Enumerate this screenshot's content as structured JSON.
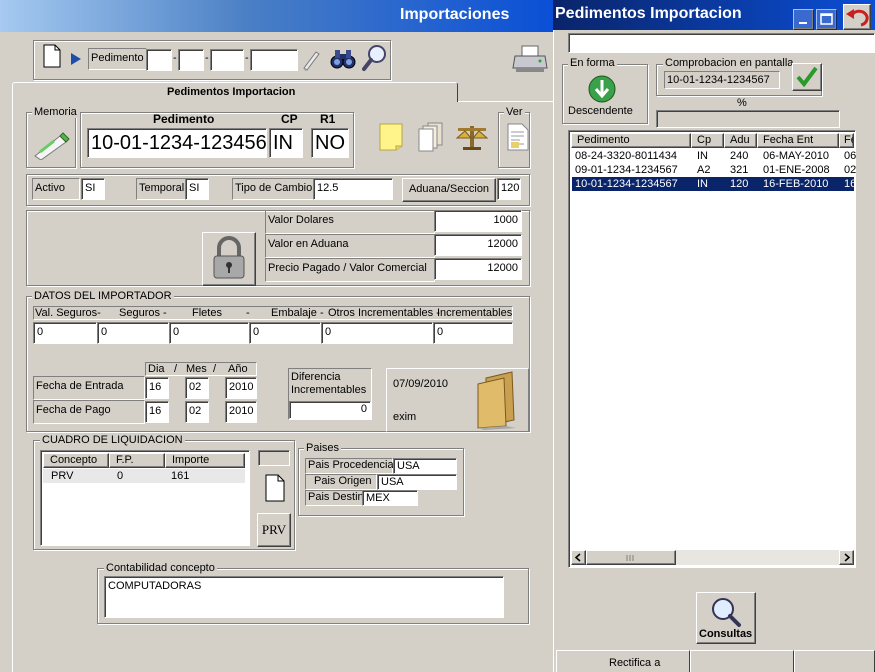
{
  "main_window": {
    "title": "Importaciones",
    "toolbar": {
      "pedimento_label": "Pedimento",
      "separators": [
        "-",
        "-",
        "-"
      ]
    },
    "tabs": [
      {
        "label": "Pedimentos Importacion"
      }
    ],
    "memoria_label": "Memoria",
    "header": {
      "pedimento_label": "Pedimento",
      "pedimento_value": "10-01-1234-1234567",
      "cp_label": "CP",
      "cp_value": "IN",
      "r1_label": "R1",
      "r1_value": "NO",
      "ver_label": "Ver"
    },
    "status_row": {
      "activo_label": "Activo",
      "activo_value": "SI",
      "temporal_label": "Temporal",
      "temporal_value": "SI",
      "tipo_cambio_label": "Tipo de Cambio",
      "tipo_cambio_value": "12.5",
      "aduana_button": "Aduana/Seccion",
      "aduana_value": "120"
    },
    "valores": {
      "valor_dolares_label": "Valor Dolares",
      "valor_dolares_value": "1000",
      "valor_aduana_label": "Valor en Aduana",
      "valor_aduana_value": "12000",
      "precio_pagado_label": "Precio Pagado   / Valor Comercial",
      "precio_pagado_value": "12000"
    },
    "importador": {
      "legend": "DATOS DEL IMPORTADOR",
      "columns": [
        "Val. Seguros-",
        "Seguros  -",
        "Fletes",
        "-",
        "Embalaje",
        "-",
        "Otros Incrementables -",
        "Incrementables"
      ],
      "values": [
        "0",
        "0",
        "0",
        "0",
        "0",
        "0"
      ]
    },
    "fechas": {
      "dia_label": "Dia",
      "slash": "/",
      "mes_label": "Mes",
      "anio_label": "Año",
      "entrada_label": "Fecha de Entrada",
      "entrada": [
        "16",
        "02",
        "2010"
      ],
      "pago_label": "Fecha de Pago",
      "pago": [
        "16",
        "02",
        "2010"
      ],
      "diferencia_label": "Diferencia Incrementables",
      "diferencia_value": "0",
      "date_display": "07/09/2010",
      "user_display": "exim"
    },
    "liquidacion": {
      "legend": "CUADRO DE LIQUIDACION",
      "headers": [
        "Concepto",
        "F.P.",
        "Importe"
      ],
      "rows": [
        {
          "concepto": "PRV",
          "fp": "0",
          "importe": "161"
        }
      ],
      "prv_button": "PRV"
    },
    "paises": {
      "legend": "Paises",
      "procedencia_label": "Pais Procedencia",
      "procedencia_value": "USA",
      "origen_label": "Pais Origen",
      "origen_value": "USA",
      "destino_label": "Pais Destin",
      "destino_value": "MEX"
    },
    "contabilidad": {
      "legend": "Contabilidad concepto",
      "value": "COMPUTADORAS"
    }
  },
  "side_window": {
    "title": "Pedimentos Importacion",
    "en_forma_label": "En forma",
    "descendente_label": "Descendente",
    "comprobacion_label": "Comprobacion en pantalla",
    "comprobacion_value": "10-01-1234-1234567",
    "percent_label": "%",
    "list": {
      "headers": [
        "Pedimento",
        "Cp",
        "Adu",
        "Fecha Ent",
        "Fe"
      ],
      "rows": [
        [
          "08-24-3320-8011434",
          "IN",
          "240",
          "06-MAY-2010",
          "06"
        ],
        [
          "09-01-1234-1234567",
          "A2",
          "321",
          "01-ENE-2008",
          "02"
        ],
        [
          "10-01-1234-1234567",
          "IN",
          "120",
          "16-FEB-2010",
          "16"
        ]
      ],
      "selected_index": 2
    },
    "consultas_label": "Consultas",
    "rectifica_label": "Rectifica a"
  },
  "colors": {
    "titlebar": "#0a246a",
    "selection": "#0a246a",
    "face": "#d4d0c8"
  }
}
